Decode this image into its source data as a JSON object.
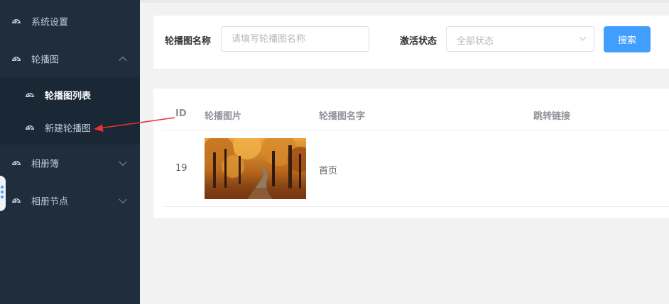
{
  "sidebar": {
    "items": [
      {
        "label": "系统设置",
        "icon": "dashboard-icon"
      },
      {
        "label": "轮播图",
        "icon": "dashboard-icon",
        "expanded": true
      },
      {
        "label": "相册簿",
        "icon": "dashboard-icon"
      },
      {
        "label": "相册节点",
        "icon": "dashboard-icon"
      }
    ],
    "submenu": [
      {
        "label": "轮播图列表",
        "icon": "dashboard-icon",
        "active": true
      },
      {
        "label": "新建轮播图",
        "icon": "dashboard-icon"
      }
    ]
  },
  "search": {
    "name_label": "轮播图名称",
    "name_placeholder": "请填写轮播图名称",
    "name_value": "",
    "status_label": "激活状态",
    "status_selected": "全部状态",
    "search_button": "搜索"
  },
  "table": {
    "columns": [
      "ID",
      "轮播图片",
      "轮播图名字",
      "跳转链接"
    ],
    "rows": [
      {
        "id": "19",
        "image": "autumn-forest-road-thumbnail",
        "name": "首页",
        "link": ""
      }
    ]
  },
  "colors": {
    "sidebar_bg": "#1f2d3d",
    "submenu_bg": "#1a2735",
    "sidebar_text": "#bfcbd9",
    "primary": "#409eff",
    "annotation_arrow": "#e8332f"
  }
}
